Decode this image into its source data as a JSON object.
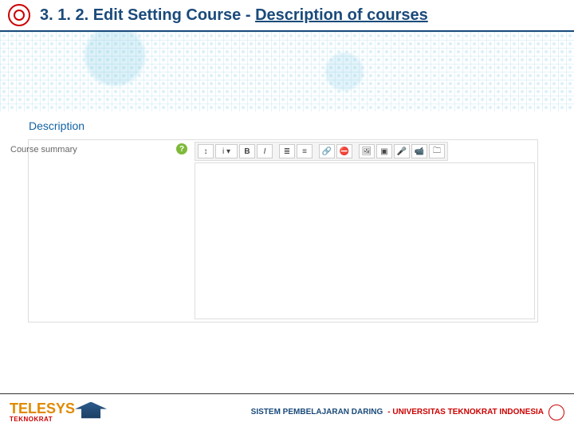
{
  "header": {
    "title_prefix": "3. 1. 2. Edit Setting Course - ",
    "title_highlight": "Description of courses"
  },
  "panel": {
    "heading": "Description",
    "label": "Course summary",
    "help": "?",
    "editor_value": ""
  },
  "toolbar": {
    "buttons": [
      {
        "name": "collapse-icon",
        "glyph": "↕"
      },
      {
        "name": "styles-dropdown",
        "glyph": "i ▾"
      },
      {
        "name": "bold-button",
        "glyph": "B"
      },
      {
        "name": "italic-button",
        "glyph": "I"
      },
      {
        "name": "bullet-list-button",
        "glyph": "≣"
      },
      {
        "name": "number-list-button",
        "glyph": "≡"
      },
      {
        "name": "link-button",
        "glyph": "🔗"
      },
      {
        "name": "unlink-button",
        "glyph": "⛔"
      },
      {
        "name": "image-button",
        "glyph": "🖼"
      },
      {
        "name": "media-button",
        "glyph": "▣"
      },
      {
        "name": "record-audio-button",
        "glyph": "🎤"
      },
      {
        "name": "record-video-button",
        "glyph": "📹"
      },
      {
        "name": "manage-files-button",
        "glyph": "🗀"
      }
    ]
  },
  "footer": {
    "brand_main": "TELESYS",
    "brand_sub": "TEKNOKRAT",
    "system_text": "SISTEM PEMBELAJARAN DARING ",
    "institution": "- UNIVERSITAS TEKNOKRAT INDONESIA"
  }
}
